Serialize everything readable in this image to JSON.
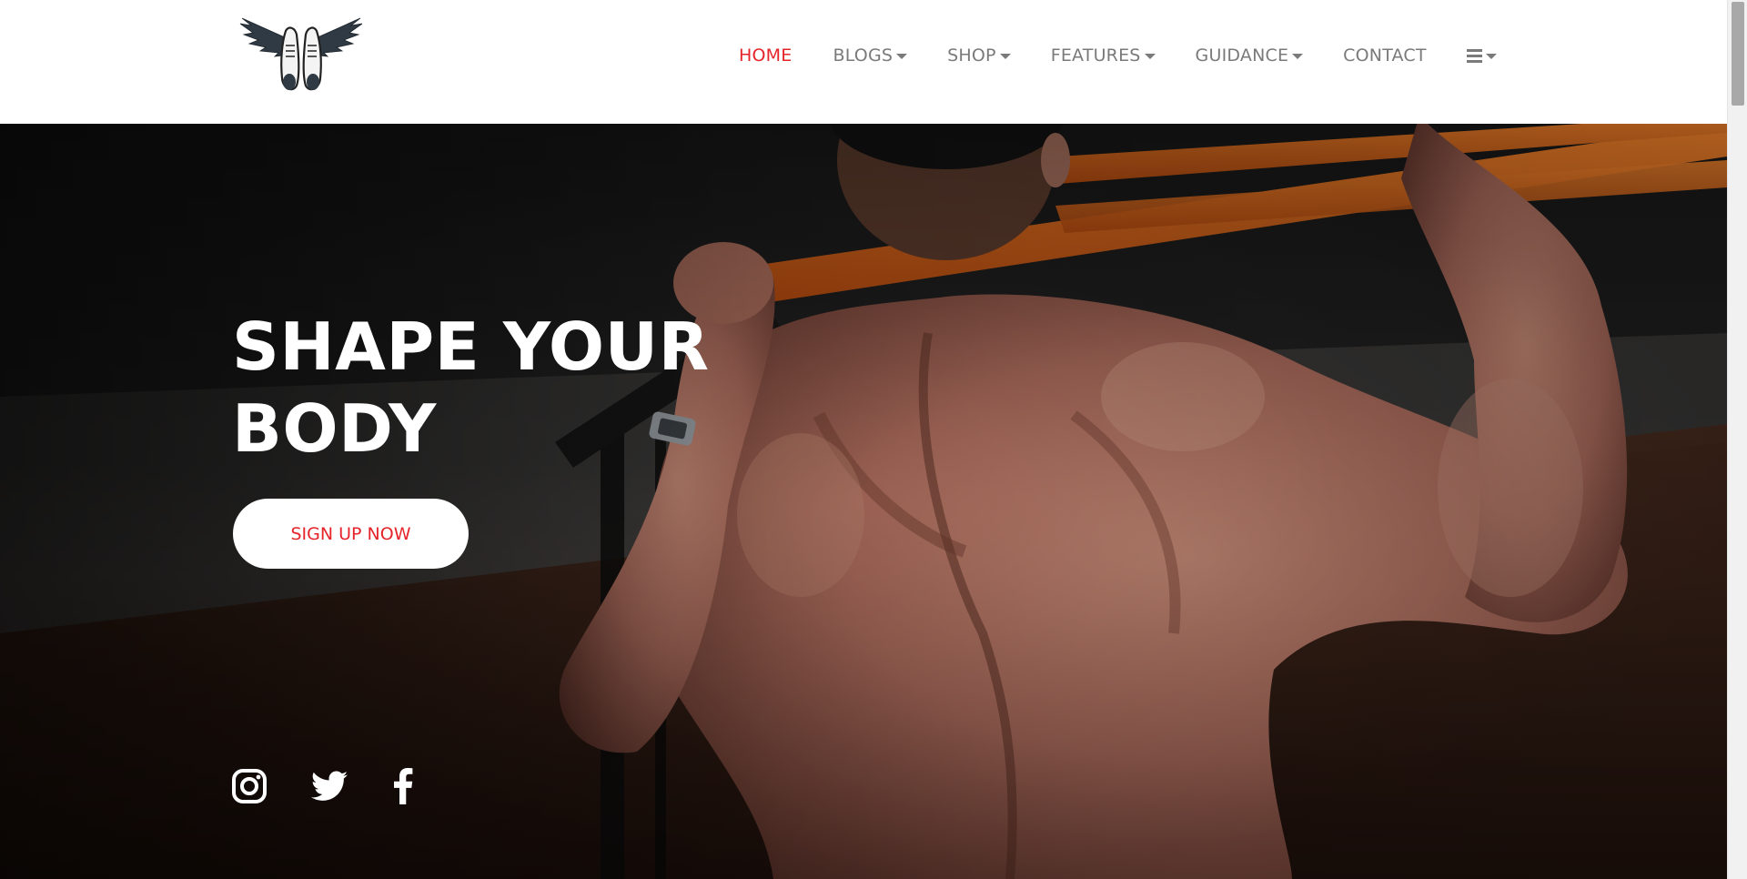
{
  "nav": {
    "items": [
      {
        "label": "HOME",
        "active": true,
        "dropdown": false
      },
      {
        "label": "BLOGS",
        "active": false,
        "dropdown": true
      },
      {
        "label": "SHOP",
        "active": false,
        "dropdown": true
      },
      {
        "label": "FEATURES",
        "active": false,
        "dropdown": true
      },
      {
        "label": "GUIDANCE",
        "active": false,
        "dropdown": true
      },
      {
        "label": "CONTACT",
        "active": false,
        "dropdown": false
      }
    ],
    "menu_icon": "hamburger-icon"
  },
  "hero": {
    "title_line1": "SHAPE YOUR",
    "title_line2": "BODY",
    "cta_label": "SIGN UP NOW"
  },
  "social": [
    "instagram-icon",
    "twitter-icon",
    "facebook-icon"
  ],
  "colors": {
    "accent": "#e5242a",
    "nav_text": "#7a7a7a",
    "header_bg": "#ffffff",
    "bar_orange": "#e0691a"
  }
}
